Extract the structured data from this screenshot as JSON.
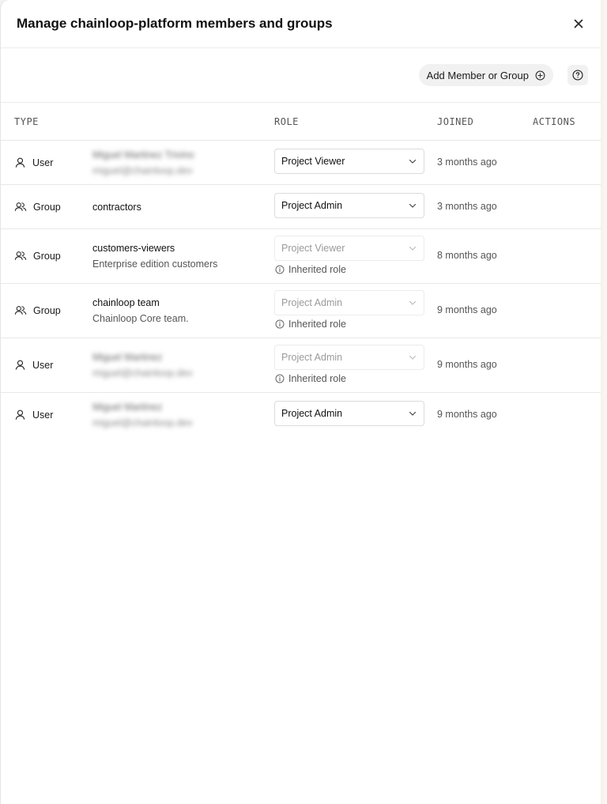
{
  "dialog": {
    "title": "Manage chainloop-platform members and groups",
    "add_button_label": "Add Member or Group"
  },
  "table": {
    "headers": {
      "type": "TYPE",
      "role": "ROLE",
      "joined": "JOINED",
      "actions": "ACTIONS"
    },
    "rows": [
      {
        "type": "User",
        "name": "Miguel Martinez Trivino",
        "subtitle": "miguel@chainloop.dev",
        "role": "Project Viewer",
        "inherited": "",
        "joined": "3 months ago"
      },
      {
        "type": "Group",
        "name": "contractors",
        "subtitle": "",
        "role": "Project Admin",
        "inherited": "",
        "joined": "3 months ago"
      },
      {
        "type": "Group",
        "name": "customers-viewers",
        "subtitle": "Enterprise edition customers",
        "role": "Project Viewer",
        "inherited": "Inherited role",
        "joined": "8 months ago"
      },
      {
        "type": "Group",
        "name": "chainloop team",
        "subtitle": "Chainloop Core team.",
        "role": "Project Admin",
        "inherited": "Inherited role",
        "joined": "9 months ago"
      },
      {
        "type": "User",
        "name": "Miguel Martinez",
        "subtitle": "miguel@chainloop.dev",
        "role": "Project Admin",
        "inherited": "Inherited role",
        "joined": "9 months ago"
      },
      {
        "type": "User",
        "name": "Miguel Martinez",
        "subtitle": "miguel@chainloop.dev",
        "role": "Project Admin",
        "inherited": "",
        "joined": "9 months ago"
      }
    ]
  }
}
